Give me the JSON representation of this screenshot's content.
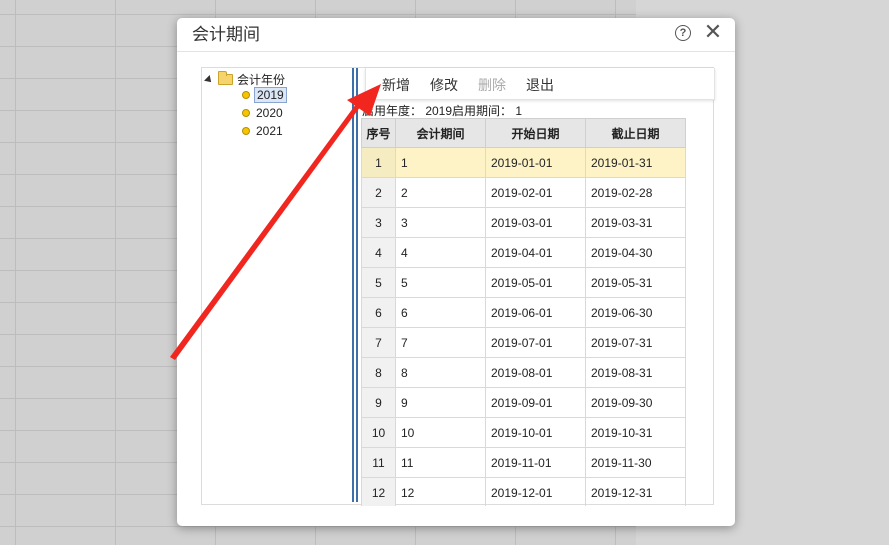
{
  "dialog": {
    "title": "会计期间"
  },
  "tree": {
    "root_label": "会计年份",
    "years": [
      "2019",
      "2020",
      "2021"
    ],
    "selected": "2019"
  },
  "toolbar": {
    "add_label": "新增",
    "edit_label": "修改",
    "delete_label": "删除",
    "exit_label": "退出"
  },
  "info": {
    "text": "启用年度： 2019启用期间： 1"
  },
  "table": {
    "headers": [
      "序号",
      "会计期间",
      "开始日期",
      "截止日期"
    ],
    "rows": [
      [
        "1",
        "1",
        "2019-01-01",
        "2019-01-31"
      ],
      [
        "2",
        "2",
        "2019-02-01",
        "2019-02-28"
      ],
      [
        "3",
        "3",
        "2019-03-01",
        "2019-03-31"
      ],
      [
        "4",
        "4",
        "2019-04-01",
        "2019-04-30"
      ],
      [
        "5",
        "5",
        "2019-05-01",
        "2019-05-31"
      ],
      [
        "6",
        "6",
        "2019-06-01",
        "2019-06-30"
      ],
      [
        "7",
        "7",
        "2019-07-01",
        "2019-07-31"
      ],
      [
        "8",
        "8",
        "2019-08-01",
        "2019-08-31"
      ],
      [
        "9",
        "9",
        "2019-09-01",
        "2019-09-30"
      ],
      [
        "10",
        "10",
        "2019-10-01",
        "2019-10-31"
      ],
      [
        "11",
        "11",
        "2019-11-01",
        "2019-11-30"
      ],
      [
        "12",
        "12",
        "2019-12-01",
        "2019-12-31"
      ]
    ]
  },
  "colors": {
    "arrow": "#f0261f",
    "splitter": "#3d6fa8",
    "selected_row": "#fdf3c6",
    "tree_dot": "#f7c500"
  },
  "icons": {
    "help": "help-circle-icon",
    "close": "close-icon",
    "folder": "folder-icon",
    "year_node": "dot-icon"
  }
}
